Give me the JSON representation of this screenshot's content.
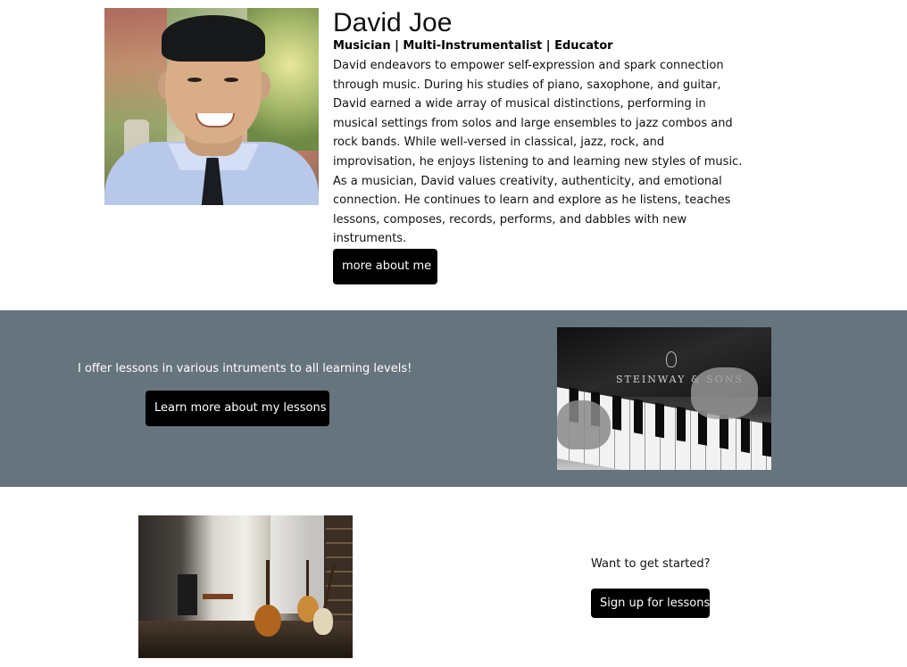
{
  "profile": {
    "name": "David Joe",
    "subtitle": "Musician | Multi-Instrumentalist | Educator",
    "bio": "David endeavors to empower self-expression and spark connection through music. During his studies of piano, saxophone, and guitar, David earned a wide array of musical distinctions, performing in musical settings from solos and large ensembles to jazz combos and rock bands. While well-versed in classical, jazz, rock, and improvisation, he enjoys listening to and learning new styles of music. As a musician, David values creativity, authenticity, and emotional connection. He continues to learn and explore as he listens, teaches lessons, composes, records, performs, and dabbles with new instruments.",
    "about_button": "more about me"
  },
  "lessons": {
    "text": "I offer lessons in various intruments to all learning levels!",
    "button": "Learn more about my lessons",
    "image_brand": "STEINWAY & SONS"
  },
  "signup": {
    "prompt": "Want to get started?",
    "button": "Sign up for lessons"
  },
  "colors": {
    "band_background": "#66747e",
    "button_background": "#000000",
    "button_text": "#ffffff"
  }
}
